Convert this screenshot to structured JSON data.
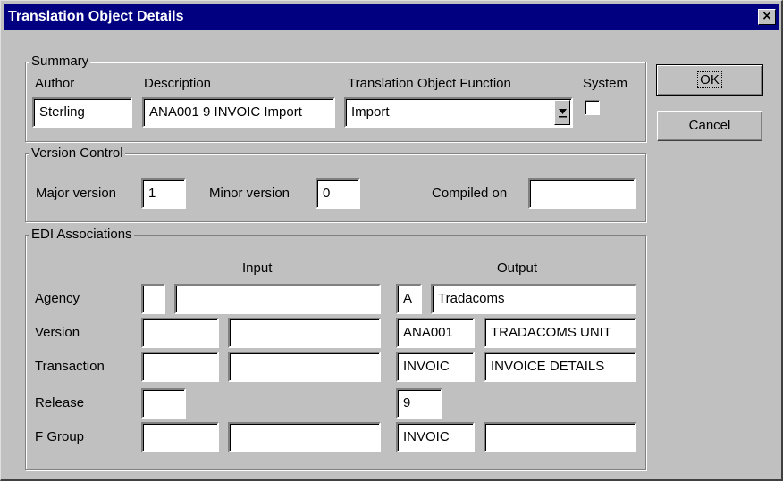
{
  "window": {
    "title": "Translation Object Details",
    "close_glyph": "×"
  },
  "buttons": {
    "ok": "OK",
    "cancel": "Cancel"
  },
  "summary": {
    "legend": "Summary",
    "author_label": "Author",
    "author_value": "Sterling",
    "description_label": "Description",
    "description_value": "ANA001 9 INVOIC Import",
    "function_label": "Translation Object Function",
    "function_value": "Import",
    "system_label": "System",
    "system_checked": false
  },
  "version_control": {
    "legend": "Version Control",
    "major_label": "Major version",
    "major_value": "1",
    "minor_label": "Minor version",
    "minor_value": "0",
    "compiled_label": "Compiled on",
    "compiled_value": ""
  },
  "edi": {
    "legend": "EDI Associations",
    "input_header": "Input",
    "output_header": "Output",
    "row_labels": {
      "agency": "Agency",
      "version": "Version",
      "transaction": "Transaction",
      "release": "Release",
      "fgroup": "F Group"
    },
    "input": {
      "agency_code": "",
      "agency_desc": "",
      "version_code": "",
      "version_desc": "",
      "transaction_code": "",
      "transaction_desc": "",
      "release": "",
      "fgroup_code": "",
      "fgroup_desc": ""
    },
    "output": {
      "agency_code": "A",
      "agency_desc": "Tradacoms",
      "version_code": "ANA001",
      "version_desc": "TRADACOMS UNIT",
      "transaction_code": "INVOIC",
      "transaction_desc": "INVOICE DETAILS",
      "release": "9",
      "fgroup_code": "INVOIC",
      "fgroup_desc": ""
    }
  }
}
